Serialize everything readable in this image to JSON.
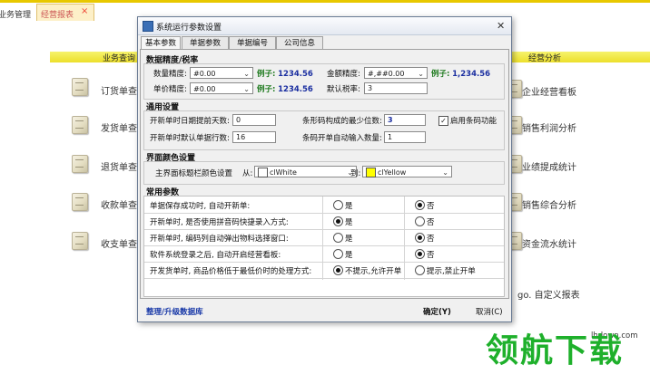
{
  "app": {
    "top_tabs": [
      "业务管理",
      "经营报表"
    ],
    "column_headers": [
      "业务查询",
      "经营分析"
    ],
    "left_items": [
      "订货单查",
      "发货单查",
      "退货单查",
      "收款单查",
      "收支单查"
    ],
    "right_items": [
      "企业经营看板",
      "销售利润分析",
      "业绩提成统计",
      "销售综合分析",
      "资金流水统计",
      "go. 自定义报表"
    ]
  },
  "dialog": {
    "title": "系统运行参数设置",
    "tabs": [
      "基本参数",
      "单据参数",
      "单据编号",
      "公司信息"
    ],
    "precision": {
      "heading": "数据精度/税率",
      "qty_label": "数量精度:",
      "qty_value": "#0.00",
      "price_label": "单价精度:",
      "price_value": "#0.00",
      "amount_label": "金额精度:",
      "amount_value": "#,##0.00",
      "tax_label": "默认税率:",
      "tax_value": "3",
      "example_label": "例子:",
      "qty_example": "1234.56",
      "price_example": "1234.56",
      "amount_example": "1,234.56"
    },
    "general": {
      "heading": "通用设置",
      "date_label": "开新单时日期提前天数:",
      "date_value": "0",
      "rows_label": "开新单时默认单据行数:",
      "rows_value": "16",
      "barcode_digits_label": "条形码构成的最少位数:",
      "barcode_digits_value": "3",
      "barcode_enable_label": "启用条码功能",
      "barcode_enable_checked": true,
      "barcode_qty_label": "条码开单自动输入数量:",
      "barcode_qty_value": "1"
    },
    "colors": {
      "heading": "界面颜色设置",
      "main_label": "主界面标题栏颜色设置",
      "from_label": "从:",
      "from_value": "clWhite",
      "from_color": "#ffffff",
      "to_label": "到:",
      "to_value": "clYellow",
      "to_color": "#ffff00"
    },
    "common": {
      "heading": "常用参数",
      "rows": [
        {
          "label": "单据保存成功时, 自动开新单:",
          "opt_a": "是",
          "opt_b": "否",
          "selected": "b"
        },
        {
          "label": "开新单时, 是否使用拼音码快捷录入方式:",
          "opt_a": "是",
          "opt_b": "否",
          "selected": "a"
        },
        {
          "label": "开新单时, 编码列自动弹出物料选择窗口:",
          "opt_a": "是",
          "opt_b": "否",
          "selected": "b"
        },
        {
          "label": "软件系统登录之后, 自动开启经营看板:",
          "opt_a": "是",
          "opt_b": "否",
          "selected": "b"
        },
        {
          "label": "开发货单时, 商品价格低于最低价时的处理方式:",
          "opt_a": "不提示,允许开单",
          "opt_b": "提示,禁止开单",
          "selected": "a"
        }
      ]
    },
    "footer": {
      "link": "整理/升级数据库",
      "ok": "确定(Y)",
      "cancel": "取消(C)"
    }
  },
  "watermark": {
    "url": "lhdown.com",
    "text": "领航下载"
  }
}
